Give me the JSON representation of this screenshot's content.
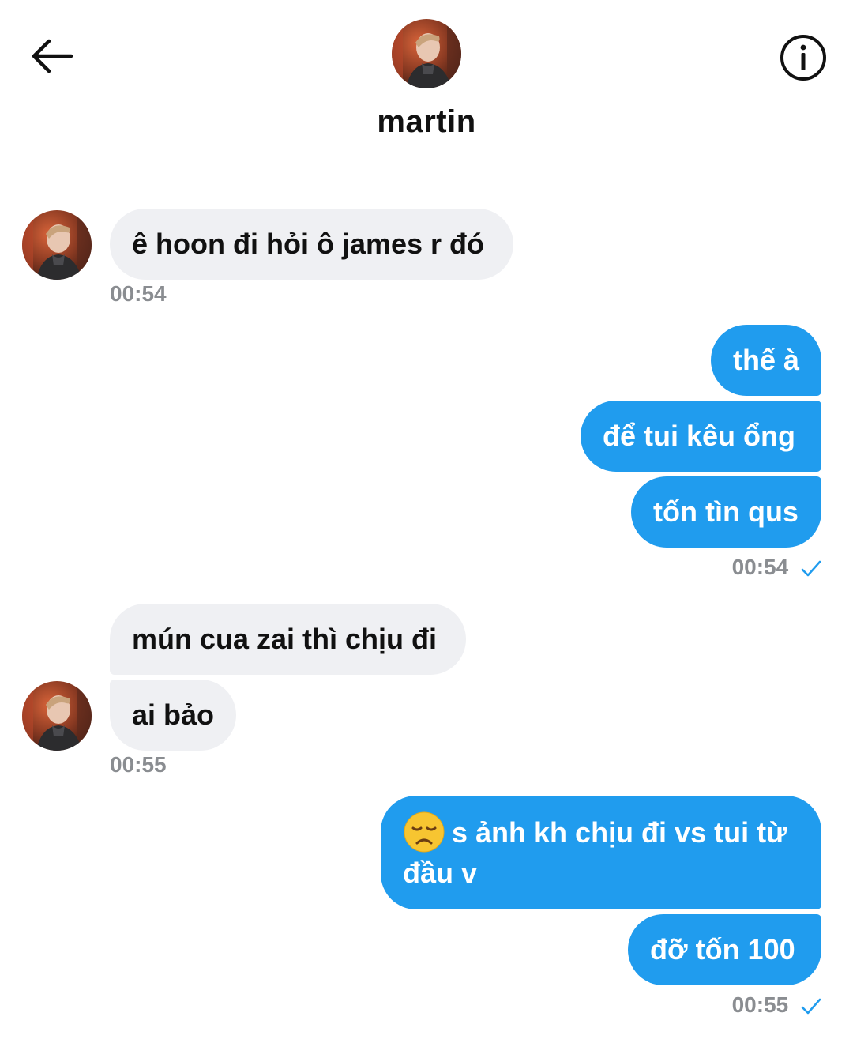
{
  "header": {
    "contact_name": "martin",
    "back_icon": "arrow-left-icon",
    "info_icon": "info-icon"
  },
  "colors": {
    "outgoing_bubble": "#209cee",
    "incoming_bubble": "#eff0f3",
    "timestamp": "#8a8d91",
    "read_check": "#209cee"
  },
  "messages": {
    "m1": "ê hoon đi hỏi ô james r đó",
    "t1": "00:54",
    "m2": "thế à",
    "m3": "để tui kêu ổng",
    "m4": "tốn tìn qus",
    "t2": "00:54",
    "m5": "mún cua zai thì chịu đi",
    "m6": "ai bảo",
    "t3": "00:55",
    "m7": "s ảnh kh chịu đi vs tui từ đầu v",
    "m7_emoji": "disappointed-face-emoji",
    "m8": "đỡ tốn 100",
    "t4": "00:55"
  }
}
